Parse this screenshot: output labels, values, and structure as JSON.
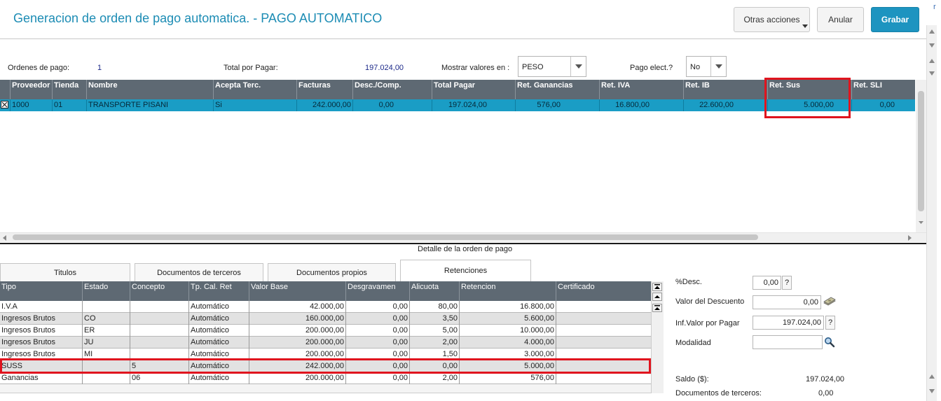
{
  "header": {
    "title": "Generacion de orden de pago automatica. - PAGO AUTOMATICO",
    "other_actions_label": "Otras acciones",
    "cancel_label": "Anular",
    "save_label": "Grabar"
  },
  "edge_letter": "r",
  "summary": {
    "orders_label": "Ordenes de pago:",
    "orders_value": "1",
    "total_label": "Total por Pagar:",
    "total_value": "197.024,00",
    "currency_label": "Mostrar valores en :",
    "currency_value": "PESO",
    "electronic_label": "Pago elect.?",
    "electronic_value": "No"
  },
  "main_grid": {
    "columns": [
      "Proveedor",
      "Tienda",
      "Nombre",
      "Acepta Terc.",
      "Facturas",
      "Desc./Comp.",
      "Total Pagar",
      "Ret. Ganancias",
      "Ret. IVA",
      "Ret. IB",
      "Ret. Sus",
      "Ret. SLI"
    ],
    "rows": [
      [
        "1000",
        "01",
        "TRANSPORTE PISANI",
        "Si",
        "242.000,00",
        "0,00",
        "197.024,00",
        "576,00",
        "16.800,00",
        "22.600,00",
        "5.000,00",
        "0,00"
      ]
    ],
    "row_checked": true
  },
  "detail": {
    "title": "Detalle de la orden de pago",
    "tabs": [
      "Titulos",
      "Documentos de terceros",
      "Documentos propios",
      "Retenciones"
    ],
    "active_tab": "Retenciones",
    "columns": [
      "Tipo",
      "Estado",
      "Concepto",
      "Tp. Cal. Ret",
      "Valor Base",
      "Desgravamen",
      "Alicuota",
      "Retencion",
      "Certificado"
    ],
    "rows": [
      [
        "I.V.A",
        "",
        "",
        "Automático",
        "42.000,00",
        "0,00",
        "80,00",
        "16.800,00",
        ""
      ],
      [
        "Ingresos Brutos",
        "CO",
        "",
        "Automático",
        "160.000,00",
        "0,00",
        "3,50",
        "5.600,00",
        ""
      ],
      [
        "Ingresos Brutos",
        "ER",
        "",
        "Automático",
        "200.000,00",
        "0,00",
        "5,00",
        "10.000,00",
        ""
      ],
      [
        "Ingresos Brutos",
        "JU",
        "",
        "Automático",
        "200.000,00",
        "0,00",
        "2,00",
        "4.000,00",
        ""
      ],
      [
        "Ingresos Brutos",
        "MI",
        "",
        "Automático",
        "200.000,00",
        "0,00",
        "1,50",
        "3.000,00",
        ""
      ],
      [
        "SUSS",
        "",
        "5",
        "Automático",
        "242.000,00",
        "0,00",
        "0,00",
        "5.000,00",
        ""
      ],
      [
        "Ganancias",
        "",
        "06",
        "Automático",
        "200.000,00",
        "0,00",
        "2,00",
        "576,00",
        ""
      ]
    ]
  },
  "side_panel": {
    "desc_pct_label": "%Desc.",
    "desc_pct_value": "0,00",
    "desc_value_label": "Valor del Descuento",
    "desc_value": "0,00",
    "to_pay_label": "Inf.Valor por Pagar",
    "to_pay_value": "197.024,00",
    "modality_label": "Modalidad",
    "modality_value": "",
    "help_mark": "?",
    "balance_label": "Saldo ($):",
    "balance_value": "197.024,00",
    "third_docs_label": "Documentos de terceros:",
    "third_docs_value": "0,00"
  },
  "colors": {
    "accent": "#1d94c0",
    "title": "#1c8cb4",
    "grid_header": "#5e6973",
    "selected_row": "#1a9dc5",
    "highlight": "#e0141e"
  },
  "icons": [
    "chevron-down-icon",
    "checkbox-checked-icon",
    "money-icon",
    "search-icon",
    "scroll-top-icon",
    "scroll-up-icon"
  ]
}
